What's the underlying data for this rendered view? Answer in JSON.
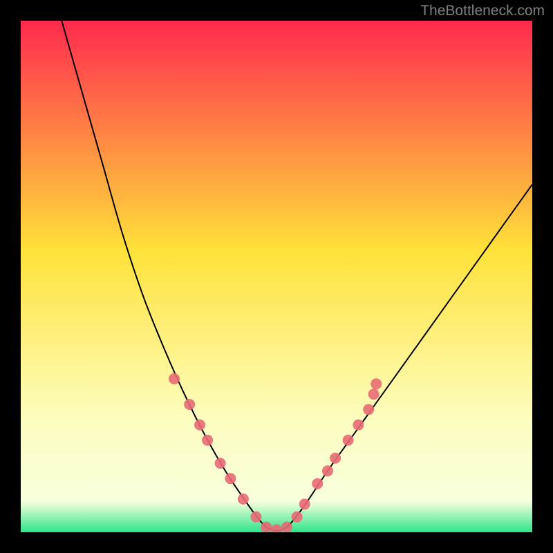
{
  "watermark": "TheBottleneck.com",
  "chart_data": {
    "type": "line",
    "title": "",
    "xlabel": "",
    "ylabel": "",
    "xlim": [
      0,
      100
    ],
    "ylim": [
      0,
      100
    ],
    "background_gradient": {
      "stops": [
        {
          "offset": 0.0,
          "color": "#ff2a4e"
        },
        {
          "offset": 0.45,
          "color": "#ffe23a"
        },
        {
          "offset": 0.78,
          "color": "#fdfec0"
        },
        {
          "offset": 0.94,
          "color": "#f8ffdc"
        },
        {
          "offset": 1.0,
          "color": "#2de58a"
        }
      ]
    },
    "curve": [
      {
        "x": 8,
        "y": 100
      },
      {
        "x": 12,
        "y": 86
      },
      {
        "x": 16,
        "y": 72
      },
      {
        "x": 20,
        "y": 58
      },
      {
        "x": 24,
        "y": 46
      },
      {
        "x": 28,
        "y": 36
      },
      {
        "x": 32,
        "y": 27
      },
      {
        "x": 36,
        "y": 19
      },
      {
        "x": 40,
        "y": 12
      },
      {
        "x": 44,
        "y": 6
      },
      {
        "x": 47,
        "y": 2
      },
      {
        "x": 49,
        "y": 0.5
      },
      {
        "x": 51,
        "y": 0.5
      },
      {
        "x": 53,
        "y": 2
      },
      {
        "x": 56,
        "y": 6
      },
      {
        "x": 60,
        "y": 12
      },
      {
        "x": 65,
        "y": 19
      },
      {
        "x": 70,
        "y": 26
      },
      {
        "x": 75,
        "y": 33
      },
      {
        "x": 80,
        "y": 40
      },
      {
        "x": 85,
        "y": 47
      },
      {
        "x": 90,
        "y": 54
      },
      {
        "x": 95,
        "y": 61
      },
      {
        "x": 100,
        "y": 68
      }
    ],
    "markers": [
      {
        "x": 30,
        "y": 30
      },
      {
        "x": 33,
        "y": 25
      },
      {
        "x": 35,
        "y": 21
      },
      {
        "x": 36.5,
        "y": 18
      },
      {
        "x": 39,
        "y": 13.5
      },
      {
        "x": 41,
        "y": 10.5
      },
      {
        "x": 43.5,
        "y": 6.5
      },
      {
        "x": 46,
        "y": 3
      },
      {
        "x": 48,
        "y": 1
      },
      {
        "x": 50,
        "y": 0.5
      },
      {
        "x": 52,
        "y": 1
      },
      {
        "x": 54,
        "y": 3
      },
      {
        "x": 55.5,
        "y": 5.5
      },
      {
        "x": 58,
        "y": 9.5
      },
      {
        "x": 60,
        "y": 12
      },
      {
        "x": 61.5,
        "y": 14.5
      },
      {
        "x": 64,
        "y": 18
      },
      {
        "x": 66,
        "y": 21
      },
      {
        "x": 68,
        "y": 24
      },
      {
        "x": 69,
        "y": 27
      },
      {
        "x": 69.5,
        "y": 29
      }
    ],
    "marker_style": {
      "fill": "#e86a76",
      "opacity": 0.9,
      "r": 8
    }
  }
}
